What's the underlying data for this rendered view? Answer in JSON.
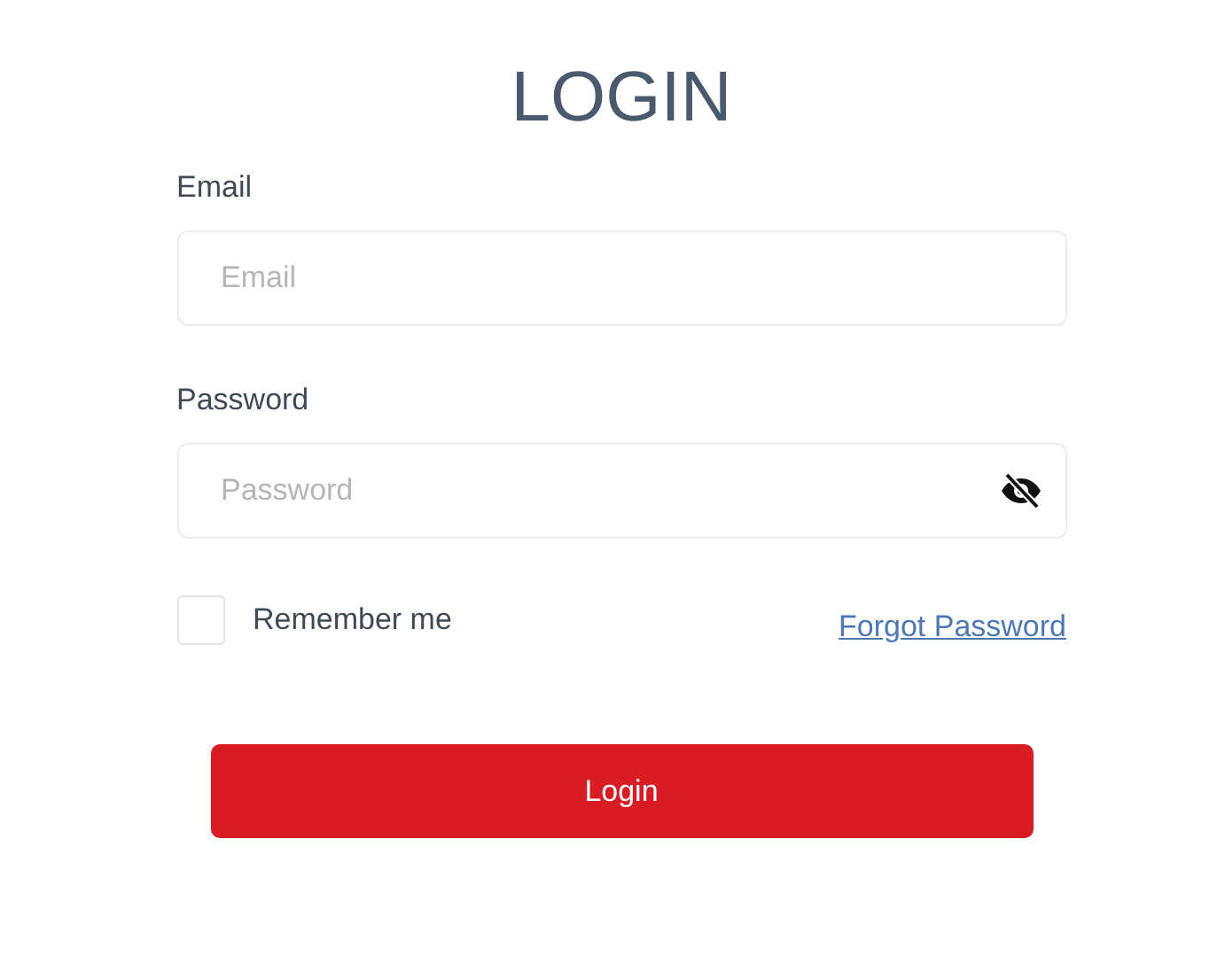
{
  "title": "LOGIN",
  "fields": [
    {
      "label": "Email",
      "placeholder": "Email",
      "kind": "text"
    },
    {
      "label": "Password",
      "placeholder": "Password",
      "kind": "password"
    }
  ],
  "remember": {
    "label": "Remember me",
    "checked": false
  },
  "forgot_link": "Forgot Password",
  "submit": "Login"
}
